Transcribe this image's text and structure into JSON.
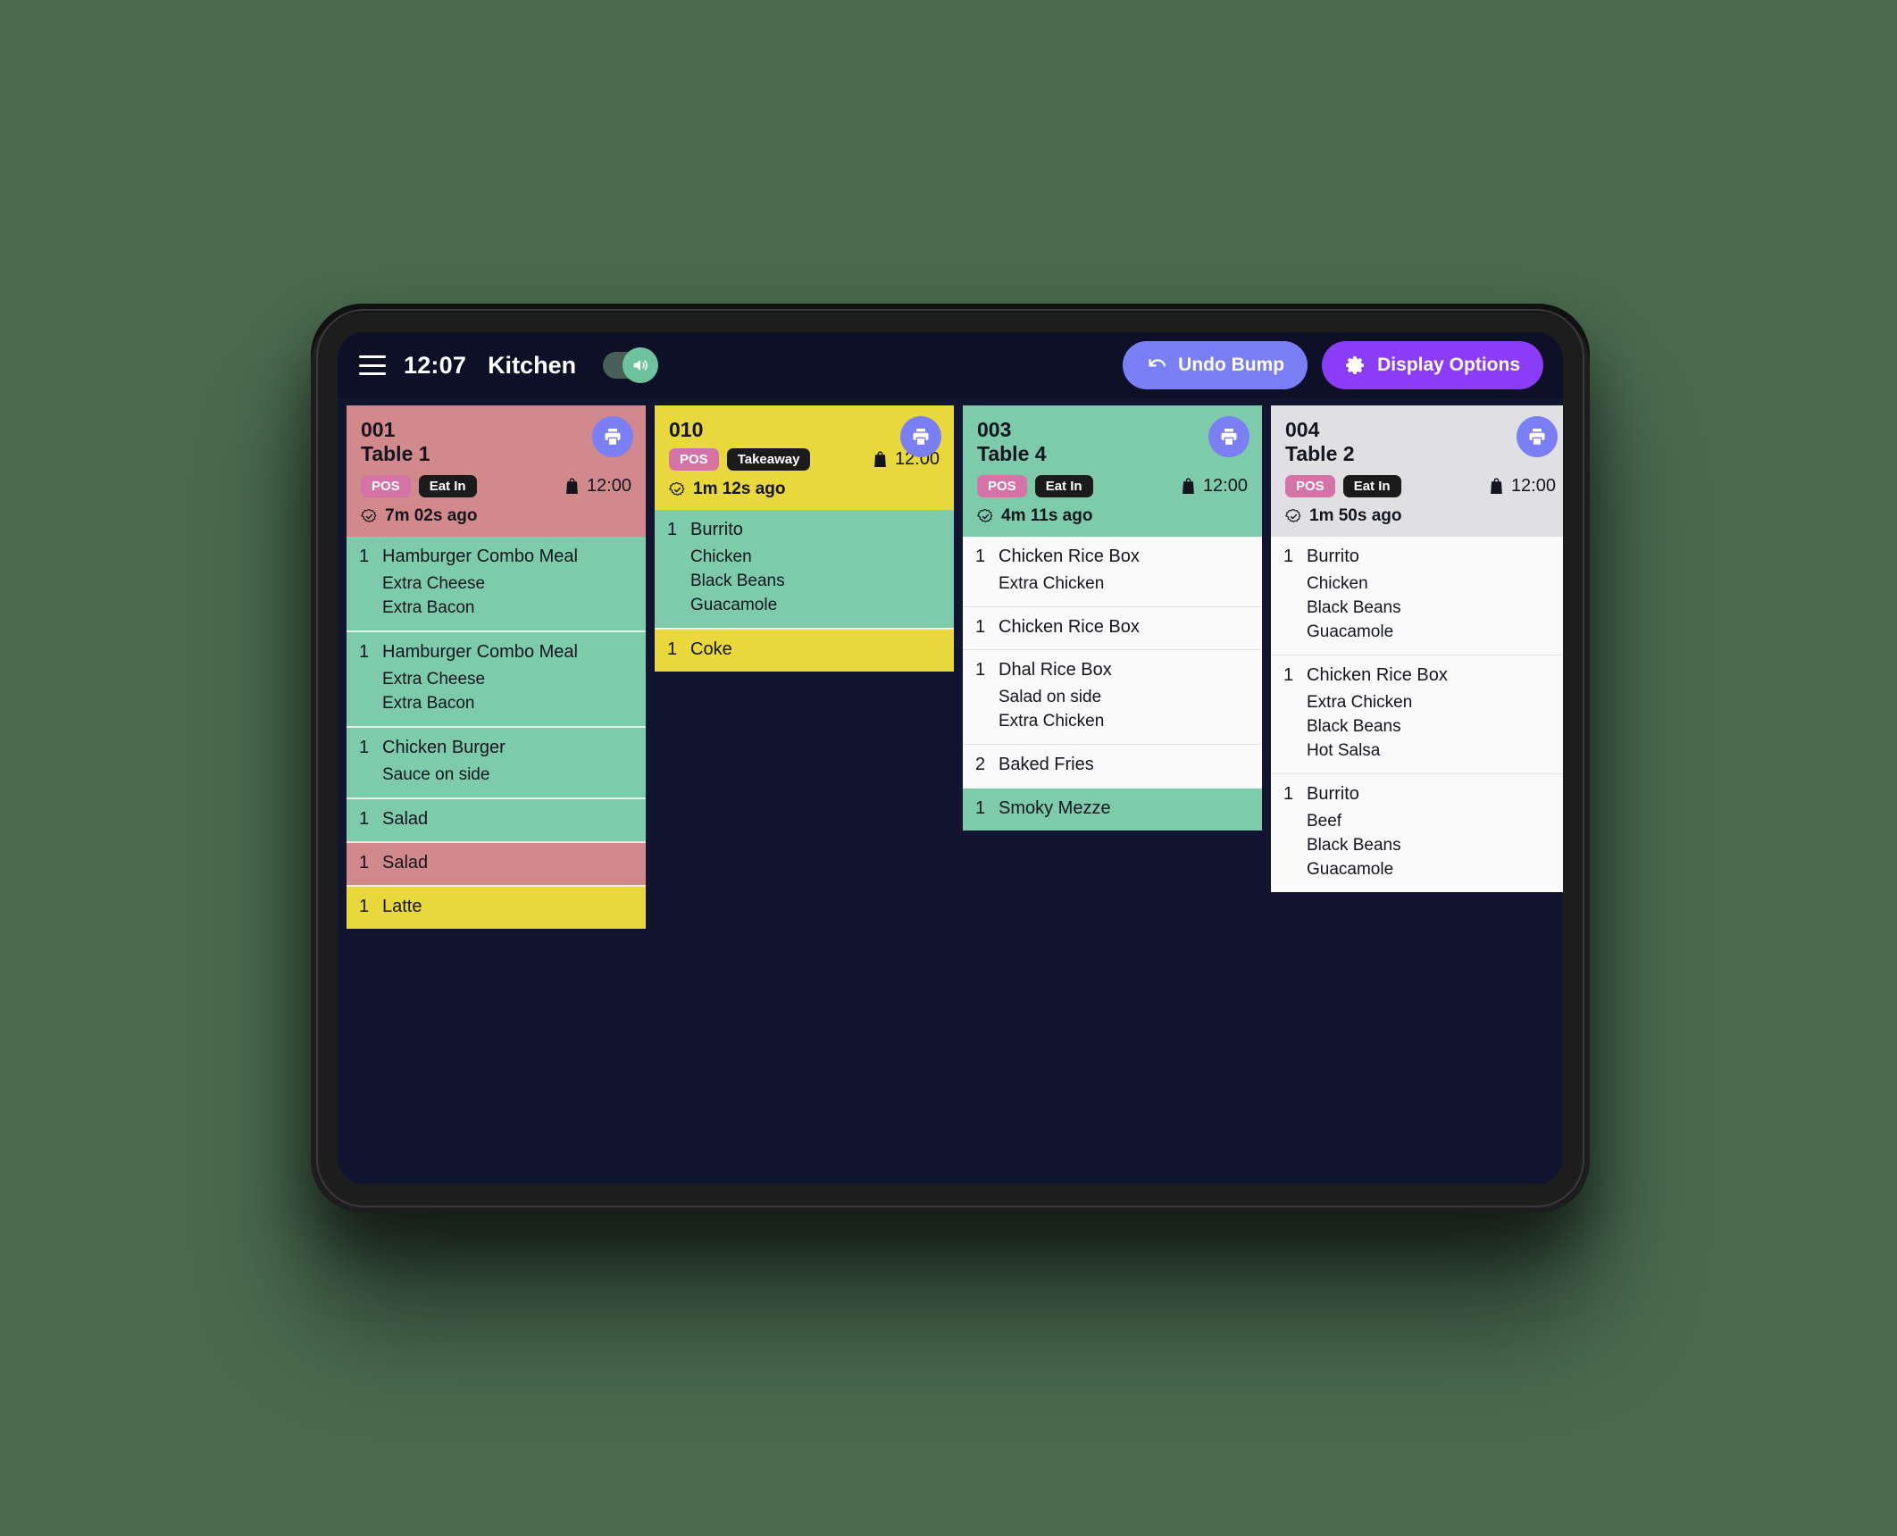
{
  "topbar": {
    "clock": "12:07",
    "station": "Kitchen",
    "sound_enabled": true,
    "undo_label": "Undo Bump",
    "display_label": "Display Options"
  },
  "colors": {
    "app_bg": "#121530",
    "topbar_bg": "#0d1026",
    "green": "#7dcbaa",
    "red": "#d2898c",
    "yellow": "#e8d83c",
    "gray": "#e0e0e2",
    "white": "#fafafa",
    "badge_pos": "#d673a6",
    "badge_type": "#1b1b1b",
    "undo_btn": "#7b7ff5",
    "display_btn": "#8b3cf7",
    "printer_btn": "#7b7ff5"
  },
  "orders": [
    {
      "number": "001",
      "table": "Table 1",
      "source_badge": "POS",
      "type_badge": "Eat In",
      "due_time": "12:00",
      "elapsed": "7m 02s ago",
      "header_color": "red",
      "items": [
        {
          "qty": "1",
          "name": "Hamburger Combo Meal",
          "color": "green",
          "mods": [
            "Extra Cheese",
            "Extra Bacon"
          ]
        },
        {
          "qty": "1",
          "name": "Hamburger Combo Meal",
          "color": "green",
          "mods": [
            "Extra Cheese",
            "Extra Bacon"
          ]
        },
        {
          "qty": "1",
          "name": "Chicken Burger",
          "color": "green",
          "mods": [
            "Sauce on side"
          ]
        },
        {
          "qty": "1",
          "name": "Salad",
          "color": "green",
          "mods": []
        },
        {
          "qty": "1",
          "name": "Salad",
          "color": "red",
          "mods": []
        },
        {
          "qty": "1",
          "name": "Latte",
          "color": "yellow",
          "mods": []
        }
      ]
    },
    {
      "number": "010",
      "table": "",
      "source_badge": "POS",
      "type_badge": "Takeaway",
      "due_time": "12:00",
      "elapsed": "1m 12s ago",
      "header_color": "yellow",
      "items": [
        {
          "qty": "1",
          "name": "Burrito",
          "color": "green",
          "mods": [
            "Chicken",
            "Black Beans",
            "Guacamole"
          ]
        },
        {
          "qty": "1",
          "name": "Coke",
          "color": "yellow",
          "mods": []
        }
      ]
    },
    {
      "number": "003",
      "table": "Table 4",
      "source_badge": "POS",
      "type_badge": "Eat In",
      "due_time": "12:00",
      "elapsed": "4m 11s ago",
      "header_color": "green",
      "items": [
        {
          "qty": "1",
          "name": "Chicken Rice Box",
          "color": "white",
          "mods": [
            "Extra Chicken"
          ]
        },
        {
          "qty": "1",
          "name": "Chicken Rice Box",
          "color": "white",
          "mods": []
        },
        {
          "qty": "1",
          "name": "Dhal Rice Box",
          "color": "white",
          "mods": [
            "Salad on side",
            "Extra Chicken"
          ]
        },
        {
          "qty": "2",
          "name": "Baked Fries",
          "color": "white",
          "mods": []
        },
        {
          "qty": "1",
          "name": "Smoky Mezze",
          "color": "green",
          "mods": []
        }
      ]
    },
    {
      "number": "004",
      "table": "Table 2",
      "source_badge": "POS",
      "type_badge": "Eat In",
      "due_time": "12:00",
      "elapsed": "1m 50s ago",
      "header_color": "gray",
      "items": [
        {
          "qty": "1",
          "name": "Burrito",
          "color": "white",
          "mods": [
            "Chicken",
            "Black Beans",
            "Guacamole"
          ]
        },
        {
          "qty": "1",
          "name": "Chicken Rice Box",
          "color": "white",
          "mods": [
            "Extra Chicken",
            "Black Beans",
            "Hot Salsa"
          ]
        },
        {
          "qty": "1",
          "name": "Burrito",
          "color": "white",
          "mods": [
            "Beef",
            "Black Beans",
            "Guacamole"
          ]
        }
      ]
    }
  ]
}
